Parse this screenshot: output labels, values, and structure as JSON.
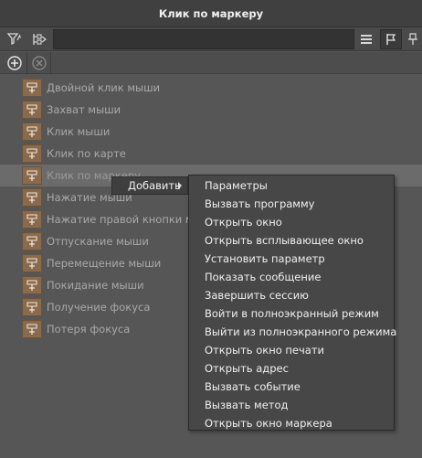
{
  "window": {
    "title": "Клик по маркеру"
  },
  "toolbar": {
    "search_value": "",
    "left_buttons": [
      "filter-icon",
      "expand-icon"
    ],
    "right_buttons": [
      "list-view-icon",
      "flag-icon",
      "pin-icon"
    ]
  },
  "toolbar2": {
    "buttons": [
      "add-icon",
      "remove-icon"
    ]
  },
  "tree": {
    "items": [
      {
        "label": "Двойной клик мыши"
      },
      {
        "label": "Захват мыши"
      },
      {
        "label": "Клик мыши"
      },
      {
        "label": "Клик по карте"
      },
      {
        "label": "Клик по маркеру",
        "selected": true
      },
      {
        "label": "Нажатие мыши"
      },
      {
        "label": "Нажатие правой кнопки мыши"
      },
      {
        "label": "Отпускание мыши"
      },
      {
        "label": "Перемещение мыши"
      },
      {
        "label": "Покидание мыши"
      },
      {
        "label": "Получение фокуса"
      },
      {
        "label": "Потеря фокуса"
      }
    ]
  },
  "context_menu": {
    "add_label": "Добавить",
    "submenu": [
      "Параметры",
      "Вызвать программу",
      "Открыть окно",
      "Открыть всплывающее окно",
      "Установить параметр",
      "Показать сообщение",
      "Завершить сессию",
      "Войти в полноэкранный режим",
      "Выйти из полноэкранного режима",
      "Открыть окно печати",
      "Открыть адрес",
      "Вызвать событие",
      "Вызвать метод",
      "Открыть окно маркера"
    ]
  }
}
